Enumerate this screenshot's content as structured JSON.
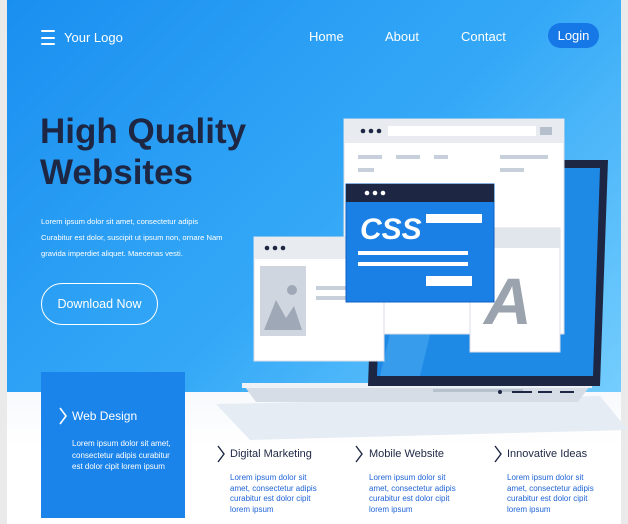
{
  "header": {
    "logo_text": "Your Logo",
    "nav": {
      "home": "Home",
      "about": "About",
      "contact": "Contact"
    },
    "login_label": "Login"
  },
  "hero": {
    "title_line1": "High Quality",
    "title_line2": "Websites",
    "description": "Lorem ipsum dolor sit amet, consectetur adipis Curabitur est dolor, suscipit ut ipsum non, ornare Nam gravida imperdiet aliquet. Maecenas vesti.",
    "download_label": "Download Now"
  },
  "illustration": {
    "css_label": "CSS",
    "font_label": "A"
  },
  "services": [
    {
      "title": "Web Design",
      "text": "Lorem ipsum dolor sit amet, consectetur adipis curabitur est dolor cipit lorem ipsum"
    },
    {
      "title": "Digital Marketing",
      "text": "Lorem ipsum dolor sit amet, consectetur adipis curabitur est dolor cipit lorem ipsum"
    },
    {
      "title": "Mobile Website",
      "text": "Lorem ipsum dolor sit amet, consectetur adipis curabitur est dolor cipit lorem ipsum"
    },
    {
      "title": "Innovative Ideas",
      "text": "Lorem ipsum dolor sit amet, consectetur adipis curabitur est dolor cipit lorem ipsum"
    }
  ],
  "colors": {
    "hero_gradient_start": "#1a8ff0",
    "hero_gradient_end": "#74cdfd",
    "accent": "#1677e6",
    "title": "#1d2744",
    "card": "#1a84ea"
  }
}
